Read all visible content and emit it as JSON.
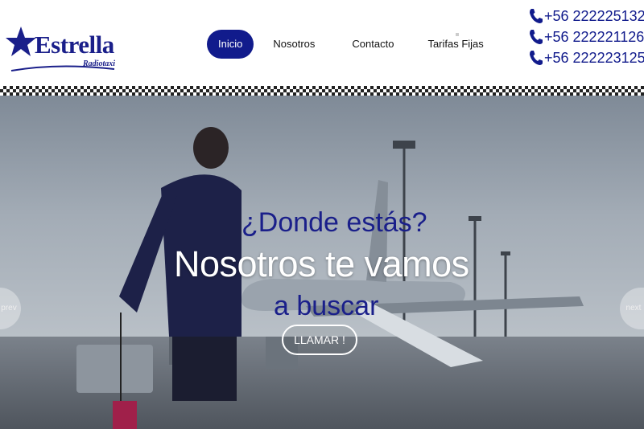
{
  "brand": {
    "name": "Estrella",
    "subtitle": "Radiotaxi",
    "color": "#1a1f8a"
  },
  "nav": {
    "items": [
      {
        "label": "Inicio",
        "active": true
      },
      {
        "label": "Nosotros",
        "active": false
      },
      {
        "label": "Contacto",
        "active": false
      },
      {
        "label": "Tarifas Fijas",
        "active": false
      }
    ],
    "active_color": "#111b8c"
  },
  "phones": [
    {
      "icon": "phone-icon",
      "number": "+56 222225132"
    },
    {
      "icon": "phone-icon",
      "number": "+56 222221126"
    },
    {
      "icon": "phone-icon",
      "number": "+56 222223125"
    }
  ],
  "hero": {
    "question": "¿Donde estás?",
    "title": "Nosotros te vamos",
    "subtitle": "a buscar",
    "cta_label": "LLAMAR !",
    "prev_label": "prev",
    "next_label": "next"
  }
}
